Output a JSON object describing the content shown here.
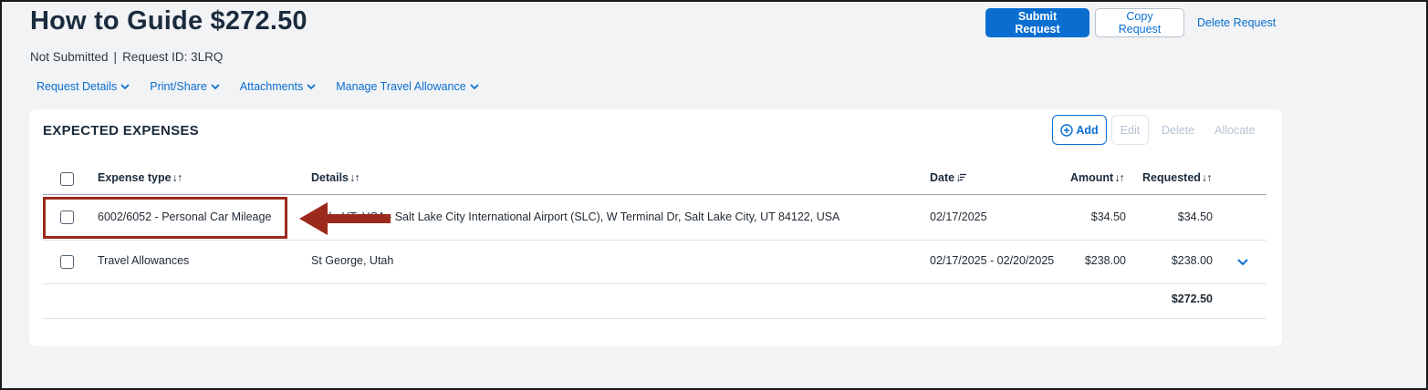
{
  "header": {
    "title": "How to Guide $272.50",
    "status": "Not Submitted",
    "separator": "|",
    "request_id": "Request ID: 3LRQ"
  },
  "actions": {
    "submit": "Submit Request",
    "copy": "Copy Request",
    "delete": "Delete Request"
  },
  "menus": [
    {
      "label": "Request Details",
      "icon": "chevron-down-icon"
    },
    {
      "label": "Print/Share",
      "icon": "chevron-down-icon"
    },
    {
      "label": "Attachments",
      "icon": "chevron-down-icon"
    },
    {
      "label": "Manage Travel Allowance",
      "icon": "chevron-down-icon"
    }
  ],
  "expenses": {
    "title": "EXPECTED EXPENSES",
    "add_label": "Add",
    "edit_label": "Edit",
    "delete_label": "Delete",
    "allocate_label": "Allocate",
    "columns": {
      "expense_type": "Expense type",
      "details": "Details",
      "date": "Date",
      "amount": "Amount",
      "requested": "Requested"
    },
    "sort_glyph": "↓↑",
    "date_sort_glyph": "↓",
    "rows": [
      {
        "expense_type": "6002/6052 - Personal Car Mileage",
        "details": "Utah, UT, USA - Salt Lake City International Airport (SLC), W Terminal Dr, Salt Lake City, UT 84122, USA",
        "date": "02/17/2025",
        "amount": "$34.50",
        "requested": "$34.50"
      },
      {
        "expense_type": "Travel Allowances",
        "details": "St George, Utah",
        "date": "02/17/2025 - 02/20/2025",
        "amount": "$238.00",
        "requested": "$238.00",
        "icon": "chevron-down-icon"
      }
    ],
    "total": "$272.50"
  },
  "colors": {
    "accent": "#0a6ed1",
    "annotation": "#9b2a1c"
  }
}
